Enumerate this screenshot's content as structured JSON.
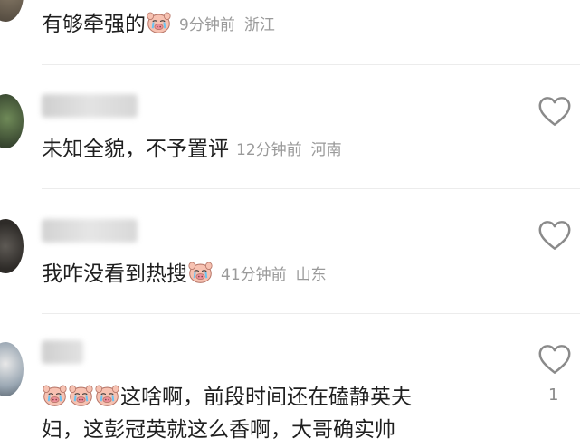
{
  "comments": [
    {
      "text": "有够牵强的",
      "time": "9分钟前",
      "location": "浙江",
      "emoji": "crying-pig-emoji"
    },
    {
      "text": "未知全貌，不予置评",
      "time": "12分钟前",
      "location": "河南",
      "like_icon": "heart-outline-icon"
    },
    {
      "text": "我咋没看到热搜",
      "time": "41分钟前",
      "location": "山东",
      "emoji": "crying-pig-emoji",
      "like_icon": "heart-outline-icon"
    },
    {
      "line1": "这啥啊，前段时间还在磕静英夫",
      "line2": "妇，这彭冠英就这么香啊，大哥确实帅",
      "emoji": "crying-pig-emoji",
      "emoji_count": 3,
      "likes": "1",
      "like_icon": "heart-outline-icon"
    }
  ],
  "colors": {
    "text": "#1f1f1f",
    "meta": "#9a9a9a",
    "divider": "#ececec",
    "heart": "#8a8a8a"
  }
}
